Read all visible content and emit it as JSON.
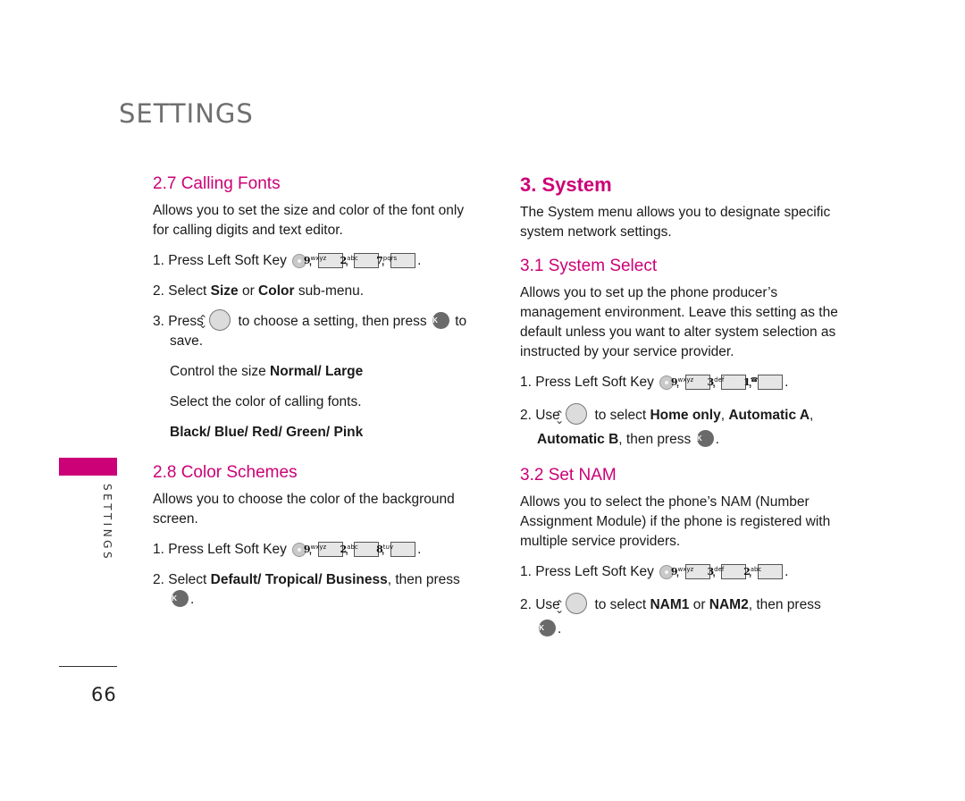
{
  "header": {
    "title": "SETTINGS"
  },
  "sidebar": {
    "label": "SETTINGS",
    "accent_color": "#cc0077"
  },
  "footer": {
    "page_number": "66"
  },
  "keys": {
    "soft_key": "left-soft-key",
    "k9": {
      "digit": "9",
      "letters": "wxyz"
    },
    "k2": {
      "digit": "2",
      "letters": "abc"
    },
    "k7": {
      "digit": "7",
      "letters": "pqrs"
    },
    "k8": {
      "digit": "8",
      "letters": "tuv"
    },
    "k3": {
      "digit": "3",
      "letters": "def"
    },
    "k1": {
      "digit": "1",
      "letters": "☎"
    },
    "ok": "OK"
  },
  "left": {
    "calling_fonts": {
      "heading": "2.7 Calling Fonts",
      "desc": "Allows you to set the size and color of the font only for calling digits and text editor.",
      "step1_prefix": "1. Press Left Soft Key",
      "step2": {
        "a": "2. Select ",
        "b1": "Size",
        "c": " or ",
        "b2": "Color",
        "d": " sub-menu."
      },
      "step3": {
        "a": "3. Press",
        "b": "to choose a setting, then press",
        "c": "to save."
      },
      "size_line": {
        "a": "Control the size ",
        "b": "Normal/ Large"
      },
      "color_line": "Select the color of calling fonts.",
      "colors": "Black/ Blue/ Red/ Green/ Pink"
    },
    "color_schemes": {
      "heading": "2.8 Color Schemes",
      "desc": "Allows you to choose the color of the background screen.",
      "step1_prefix": "1. Press Left Soft Key",
      "step2": {
        "a": "2. Select ",
        "b": "Default/ Tropical/ Business",
        "c": ", then press"
      }
    }
  },
  "right": {
    "system": {
      "heading": "3. System",
      "desc": "The System menu allows you to designate specific system network settings."
    },
    "system_select": {
      "heading": "3.1 System Select",
      "desc": "Allows you to set up the phone producer’s management environment. Leave this setting as the default unless you want to alter system selection as instructed by your service provider.",
      "step1_prefix": "1. Press Left Soft Key",
      "step2": {
        "a": "2. Use",
        "b": "to select ",
        "c": "Home only",
        "d": ", ",
        "e": "Automatic A",
        "f": ", ",
        "g": "Automatic B",
        "h": ", then press"
      }
    },
    "set_nam": {
      "heading": "3.2 Set NAM",
      "desc": "Allows you to select the phone’s NAM (Number Assignment Module) if the phone is registered with multiple service providers.",
      "step1_prefix": "1. Press Left Soft Key",
      "step2": {
        "a": "2. Use",
        "b": "to select ",
        "c": "NAM1",
        "d": " or ",
        "e": "NAM2",
        "f": ", then press"
      }
    }
  }
}
